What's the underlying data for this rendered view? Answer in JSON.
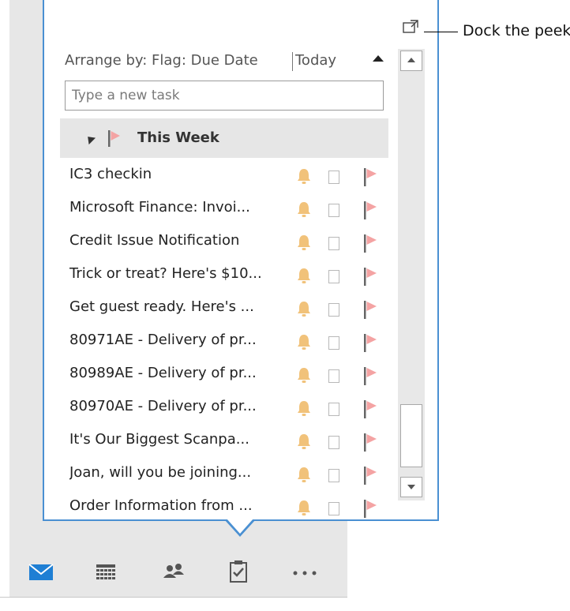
{
  "callout": {
    "label": "Dock the peek"
  },
  "arrange": {
    "label": "Arrange by: Flag: Due Date",
    "value": "Today"
  },
  "new_task": {
    "placeholder": "Type a new task"
  },
  "group": {
    "label": "This Week"
  },
  "tasks": [
    {
      "title": "IC3 checkin"
    },
    {
      "title": "Microsoft Finance: Invoi..."
    },
    {
      "title": "Credit Issue Notification"
    },
    {
      "title": "Trick or treat? Here's $10..."
    },
    {
      "title": "Get guest ready. Here's ..."
    },
    {
      "title": "80971AE - Delivery of pr..."
    },
    {
      "title": "80989AE - Delivery of pr..."
    },
    {
      "title": "80970AE - Delivery of pr..."
    },
    {
      "title": "It's Our Biggest Scanpa..."
    },
    {
      "title": "Joan, will you be joining..."
    },
    {
      "title": "Order Information from ..."
    }
  ],
  "nav": [
    "mail-icon",
    "calendar-icon",
    "people-icon",
    "tasks-icon",
    "more-icon"
  ],
  "colors": {
    "accent": "#4a90d2",
    "bell": "#f1c27a",
    "flag": "#f4a3a3",
    "mail": "#1f7fd4"
  }
}
